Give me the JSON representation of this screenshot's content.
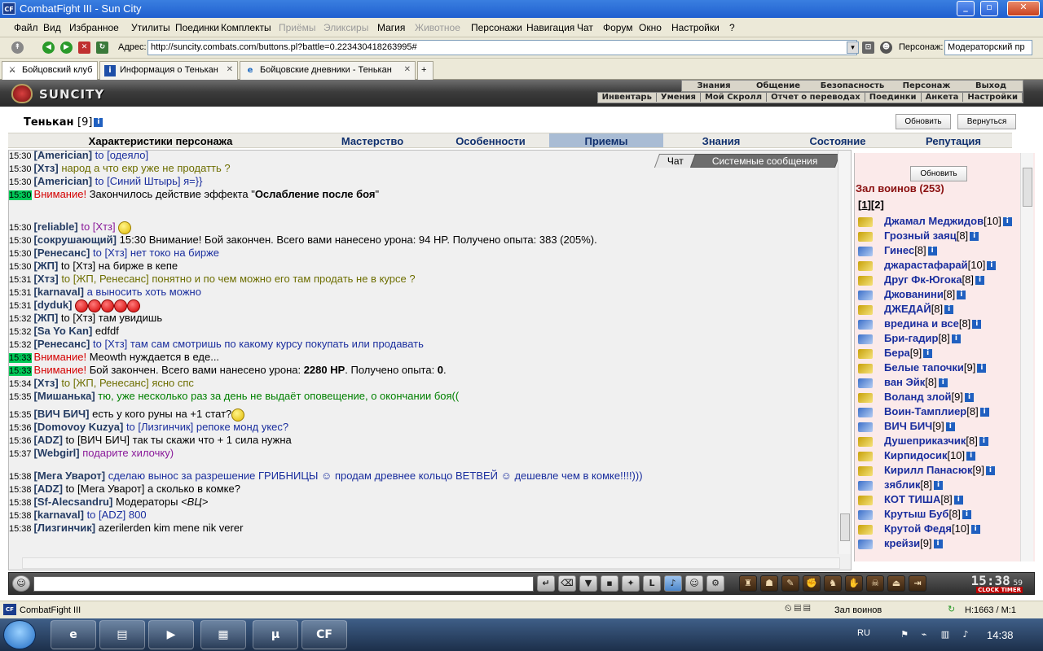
{
  "window": {
    "title": "CombatFight III - Sun City",
    "app_icon": "CF"
  },
  "menu": [
    {
      "label": "Файл",
      "disabled": false
    },
    {
      "label": "Вид",
      "disabled": false
    },
    {
      "label": "Избранное",
      "disabled": false
    },
    {
      "label": "Утилиты",
      "disabled": false
    },
    {
      "label": "Поединки",
      "disabled": false
    },
    {
      "label": "Комплекты",
      "disabled": false
    },
    {
      "label": "Приёмы",
      "disabled": true
    },
    {
      "label": "Эликсиры",
      "disabled": true
    },
    {
      "label": "Магия",
      "disabled": false
    },
    {
      "label": "Животное",
      "disabled": true
    },
    {
      "label": "Персонажи",
      "disabled": false
    },
    {
      "label": "Навигация",
      "disabled": false
    },
    {
      "label": "Чат",
      "disabled": false
    },
    {
      "label": "Форум",
      "disabled": false
    },
    {
      "label": "Окно",
      "disabled": false
    },
    {
      "label": "Настройки",
      "disabled": false
    },
    {
      "label": "?",
      "disabled": false
    }
  ],
  "address": {
    "label": "Адрес:",
    "url": "http://suncity.combats.com/buttons.pl?battle=0.223430418263995#",
    "person_label": "Персонаж:",
    "person_value": "Модераторский пр"
  },
  "tabs": [
    {
      "label": "Бойцовский клуб",
      "active": true
    },
    {
      "label": "Информация о Тенькан",
      "active": false
    },
    {
      "label": "Бойцовские дневники - Тенькан",
      "active": false
    }
  ],
  "game": {
    "logo_text": "SUNCITY",
    "nav_top": [
      "Знания",
      "Общение",
      "Безопасность",
      "Персонаж",
      "Выход"
    ],
    "nav_bottom": [
      "Инвентарь",
      "Умения",
      "Мой Скролл",
      "Отчет о переводах",
      "Поединки",
      "Анкета",
      "Настройки"
    ]
  },
  "character": {
    "name": "Тенькан",
    "level": "[9]",
    "refresh_button": "Обновить",
    "return_button": "Вернуться",
    "tabs": [
      "Характеристики персонажа",
      "Мастерство",
      "Особенности",
      "Приемы",
      "Знания",
      "Состояние",
      "Репутация"
    ],
    "selected_tab": "Приемы"
  },
  "chat": {
    "tab_chat": "Чат",
    "tab_system": "Системные сообщения",
    "messages": [
      {
        "time": "15:30",
        "hl": false,
        "parts": [
          {
            "t": "[Americian]",
            "c": "n"
          },
          {
            "t": " to [одеяло]",
            "c": "bl"
          }
        ]
      },
      {
        "time": "15:30",
        "hl": false,
        "parts": [
          {
            "t": "[Хтз]",
            "c": "n"
          },
          {
            "t": " народ а что екр уже не продатть ?",
            "c": "ol"
          }
        ]
      },
      {
        "time": "15:30",
        "hl": false,
        "parts": [
          {
            "t": "[Americian]",
            "c": "n"
          },
          {
            "t": " to [Синий Штырь] я=}}",
            "c": "bl"
          }
        ]
      },
      {
        "time": "15:30",
        "hl": true,
        "parts": [
          {
            "t": "Внимание!",
            "c": "red"
          },
          {
            "t": " Закончилось действие эффекта \"",
            "c": ""
          },
          {
            "t": "Ослабление после боя",
            "c": "b"
          },
          {
            "t": "\"",
            "c": ""
          }
        ]
      },
      {
        "time": "15:30",
        "hl": false,
        "parts": [
          {
            "t": "[reliable]",
            "c": "n"
          },
          {
            "t": " to [Хтз] ",
            "c": "pu"
          }
        ],
        "emo": 1
      },
      {
        "time": "15:30",
        "hl": false,
        "parts": [
          {
            "t": "[сокрушающий]",
            "c": "n"
          },
          {
            "t": " 15:30 Внимание! Бой закончен. Всего вами нанесено урона: 94 HP. Получено опыта: 383 (205%).",
            "c": ""
          }
        ]
      },
      {
        "time": "15:30",
        "hl": false,
        "parts": [
          {
            "t": "[Ренесанс]",
            "c": "n"
          },
          {
            "t": " to [Хтз] нет токо на бирже",
            "c": "bl"
          }
        ]
      },
      {
        "time": "15:30",
        "hl": false,
        "parts": [
          {
            "t": "[ЖП]",
            "c": "n"
          },
          {
            "t": " to [Хтз] на бирже в кепе",
            "c": ""
          }
        ]
      },
      {
        "time": "15:31",
        "hl": false,
        "parts": [
          {
            "t": "[Хтз]",
            "c": "n"
          },
          {
            "t": " to [ЖП, Ренесанс] понятно и по чем можно его там продать не в курсе ?",
            "c": "ol"
          }
        ]
      },
      {
        "time": "15:31",
        "hl": false,
        "parts": [
          {
            "t": "[karnaval]",
            "c": "n"
          },
          {
            "t": " а выносить хоть можно",
            "c": "bl"
          }
        ]
      },
      {
        "time": "15:31",
        "hl": false,
        "parts": [
          {
            "t": "[dyduk]",
            "c": "n"
          },
          {
            "t": " ",
            "c": ""
          }
        ],
        "emo": 5,
        "emo_red": true
      },
      {
        "time": "15:32",
        "hl": false,
        "parts": [
          {
            "t": "[ЖП]",
            "c": "n"
          },
          {
            "t": " to [Хтз] там увидишь",
            "c": ""
          }
        ]
      },
      {
        "time": "15:32",
        "hl": false,
        "parts": [
          {
            "t": "[Sa Yo Kan]",
            "c": "n"
          },
          {
            "t": " edfdf",
            "c": ""
          }
        ]
      },
      {
        "time": "15:32",
        "hl": false,
        "parts": [
          {
            "t": "[Ренесанс]",
            "c": "n"
          },
          {
            "t": " to [Хтз] там сам смотришь по какому курсу покупать или продавать",
            "c": "bl"
          }
        ]
      },
      {
        "time": "15:33",
        "hl": true,
        "parts": [
          {
            "t": "Внимание!",
            "c": "red"
          },
          {
            "t": " Meowth нуждается в еде...",
            "c": ""
          }
        ]
      },
      {
        "time": "15:33",
        "hl": true,
        "parts": [
          {
            "t": "Внимание!",
            "c": "red"
          },
          {
            "t": " Бой закончен. Всего вами нанесено урона: ",
            "c": ""
          },
          {
            "t": "2280 HP",
            "c": "b"
          },
          {
            "t": ". Получено опыта: ",
            "c": ""
          },
          {
            "t": "0",
            "c": "b"
          },
          {
            "t": ".",
            "c": ""
          }
        ]
      },
      {
        "time": "15:34",
        "hl": false,
        "parts": [
          {
            "t": "[Хтз]",
            "c": "n"
          },
          {
            "t": " to [ЖП, Ренесанс] ясно спс",
            "c": "ol"
          }
        ]
      },
      {
        "time": "15:35",
        "hl": false,
        "parts": [
          {
            "t": "[Мишанька]",
            "c": "n"
          },
          {
            "t": " тю, уже несколько раз за день не выдаёт оповещение, о окончании боя((",
            "c": "gr"
          }
        ]
      },
      {
        "time": "15:35",
        "hl": false,
        "parts": [
          {
            "t": "[ВИЧ БИЧ]",
            "c": "n"
          },
          {
            "t": " есть у кого руны на +1 стат?",
            "c": ""
          }
        ],
        "emo": 1
      },
      {
        "time": "15:36",
        "hl": false,
        "parts": [
          {
            "t": "[Domovoy Kuzya]",
            "c": "n"
          },
          {
            "t": " to [Лизгинчик] репоке монд укес?",
            "c": "bl"
          }
        ]
      },
      {
        "time": "15:36",
        "hl": false,
        "parts": [
          {
            "t": "[ADZ]",
            "c": "n"
          },
          {
            "t": " to [ВИЧ БИЧ] так ты скажи что + 1 сила нужна",
            "c": ""
          }
        ]
      },
      {
        "time": "15:37",
        "hl": false,
        "parts": [
          {
            "t": "[Webgirl]",
            "c": "n"
          },
          {
            "t": " подарите хилочку)",
            "c": "pu"
          }
        ]
      },
      {
        "time": "15:38",
        "hl": false,
        "parts": [
          {
            "t": "[Мега Уварот]",
            "c": "n"
          },
          {
            "t": " сделаю вынос за разрешение ГРИБНИЦЫ ☺ продам древнее кольцо ВЕТВЕЙ ☺ дешевле чем в комке!!!!)))",
            "c": "bl"
          }
        ]
      },
      {
        "time": "15:38",
        "hl": false,
        "parts": [
          {
            "t": "[ADZ]",
            "c": "n"
          },
          {
            "t": " to [Мега Уварот] а сколько в комке?",
            "c": ""
          }
        ]
      },
      {
        "time": "15:38",
        "hl": false,
        "parts": [
          {
            "t": "[Sf-Alecsandru]",
            "c": "n"
          },
          {
            "t": " Модераторы ",
            "c": ""
          },
          {
            "t": "<ВЦ>",
            "c": "i"
          }
        ]
      },
      {
        "time": "15:38",
        "hl": false,
        "parts": [
          {
            "t": "[karnaval]",
            "c": "n"
          },
          {
            "t": " to [ADZ] 800",
            "c": "bl"
          }
        ]
      },
      {
        "time": "15:38",
        "hl": false,
        "parts": [
          {
            "t": "[Лизгинчик]",
            "c": "n"
          },
          {
            "t": " azerilerden kim mene nik verer",
            "c": ""
          }
        ]
      }
    ]
  },
  "hall": {
    "refresh_button": "Обновить",
    "title": "Зал воинов (253)",
    "pages": [
      "1",
      "2"
    ],
    "users": [
      {
        "name": "Джамал Меджидов",
        "level": "[10]",
        "type": "k"
      },
      {
        "name": "Грозный заяц",
        "level": "[8]",
        "type": "k"
      },
      {
        "name": "Гинес",
        "level": "[8]",
        "type": "b"
      },
      {
        "name": "джарастафарай",
        "level": "[10]",
        "type": "k"
      },
      {
        "name": "Друг Фк-Югока",
        "level": "[8]",
        "type": "k"
      },
      {
        "name": "Джованини",
        "level": "[8]",
        "type": "b"
      },
      {
        "name": "ДЖЕДАЙ",
        "level": "[8]",
        "type": "k"
      },
      {
        "name": "вредина и все",
        "level": "[8]",
        "type": "b"
      },
      {
        "name": "Бри-гадир",
        "level": "[8]",
        "type": "b"
      },
      {
        "name": "Бера",
        "level": "[9]",
        "type": "k"
      },
      {
        "name": "Белые тапочки",
        "level": "[9]",
        "type": "k"
      },
      {
        "name": "ван Эйк",
        "level": "[8]",
        "type": "b"
      },
      {
        "name": "Воланд злой",
        "level": "[9]",
        "type": "k"
      },
      {
        "name": "Воин-Тамплиер",
        "level": "[8]",
        "type": "b"
      },
      {
        "name": "ВИЧ БИЧ",
        "level": "[9]",
        "type": "b"
      },
      {
        "name": "Душеприказчик",
        "level": "[8]",
        "type": "k"
      },
      {
        "name": "Кирпидосик",
        "level": "[10]",
        "type": "k"
      },
      {
        "name": "Кирилл Панасюк",
        "level": "[9]",
        "type": "k"
      },
      {
        "name": "зяблик",
        "level": "[8]",
        "type": "b"
      },
      {
        "name": "КОТ ТИША",
        "level": "[8]",
        "type": "k"
      },
      {
        "name": "Крутыш Буб",
        "level": "[8]",
        "type": "b"
      },
      {
        "name": "Крутой Федя",
        "level": "[10]",
        "type": "k"
      },
      {
        "name": "крейзи",
        "level": "[9]",
        "type": "b"
      }
    ]
  },
  "clock": {
    "time": "15:38",
    "seconds": "59",
    "label": "CLOCK TIMER"
  },
  "status": {
    "app": "CombatFight III",
    "location": "Зал воинов",
    "counter": "H:1663 / M:1"
  },
  "taskbar": {
    "lang": "RU",
    "time": "14:38"
  }
}
